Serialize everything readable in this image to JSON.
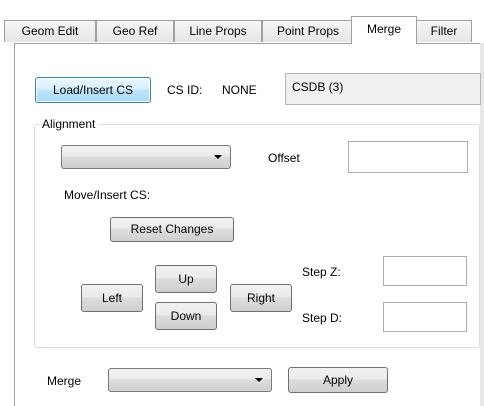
{
  "tabs": [
    {
      "label": "Geom Edit",
      "selected": false
    },
    {
      "label": "Geo Ref",
      "selected": false
    },
    {
      "label": "Line Props",
      "selected": false
    },
    {
      "label": "Point Props",
      "selected": false
    },
    {
      "label": "Merge",
      "selected": true
    },
    {
      "label": "Filter",
      "selected": false
    }
  ],
  "cs": {
    "load_button": "Load/Insert CS",
    "id_label": "CS ID:",
    "id_value": "NONE",
    "db_value": "CSDB (3)"
  },
  "alignment": {
    "group_label": "Alignment",
    "combo_value": "",
    "offset_label": "Offset",
    "offset_value": "",
    "move_insert_label": "Move/Insert CS:",
    "reset_button": "Reset Changes",
    "left_button": "Left",
    "up_button": "Up",
    "down_button": "Down",
    "right_button": "Right",
    "step_z_label": "Step Z:",
    "step_z_value": "",
    "step_d_label": "Step D:",
    "step_d_value": ""
  },
  "merge": {
    "label": "Merge",
    "combo_value": "",
    "apply_button": "Apply"
  }
}
